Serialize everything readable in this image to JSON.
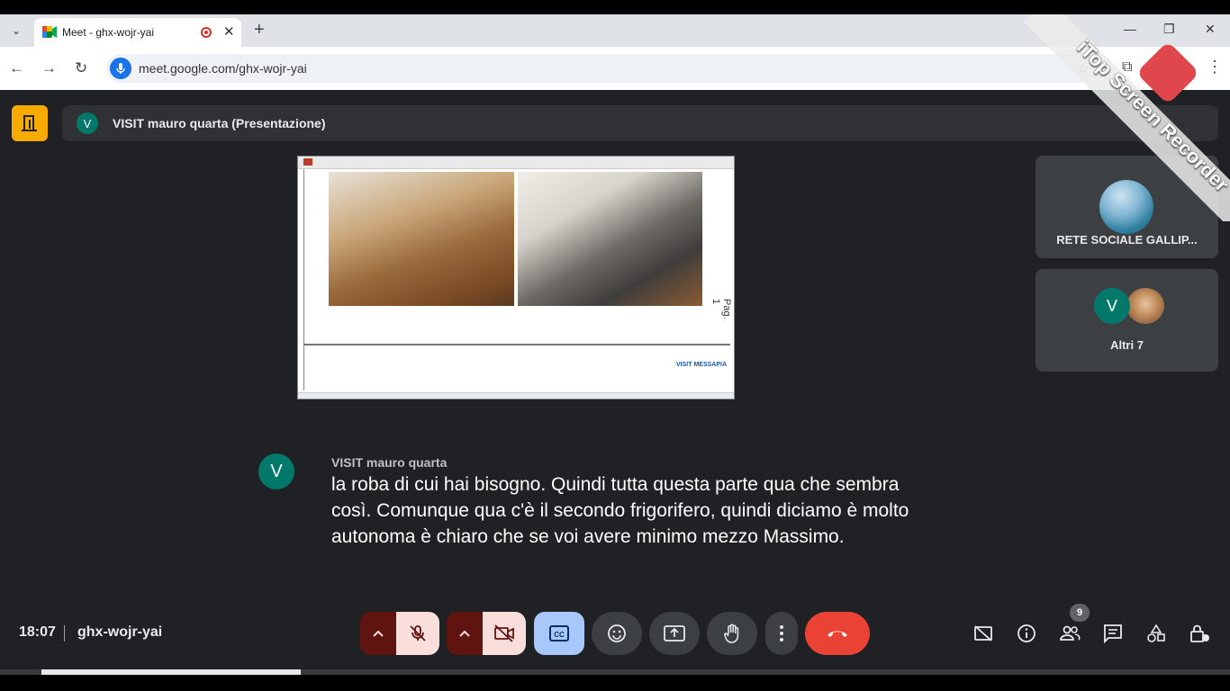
{
  "browser": {
    "tab_title": "Meet - ghx-wojr-yai",
    "tab_close": "✕",
    "new_tab": "+",
    "url": "meet.google.com/ghx-wojr-yai",
    "window_minimize": "—",
    "window_restore": "❐",
    "window_close": "✕"
  },
  "meet": {
    "presenter_initial": "V",
    "presentation_title": "VISIT mauro quarta (Presentazione)",
    "shared_screen": {
      "page_label": "Pag. 1",
      "brand": "VISIT MESSAPIA"
    },
    "participants": [
      {
        "name": "RETE SOCIALE GALLIP..."
      },
      {
        "name": "Altri 7",
        "initial": "V"
      }
    ],
    "caption": {
      "initial": "V",
      "speaker": "VISIT mauro quarta",
      "text": "la roba di cui hai bisogno. Quindi tutta questa parte qua che sembra così. Comunque qua c'è il secondo frigorifero, quindi diciamo è molto autonoma è chiaro che se voi avere minimo mezzo Massimo."
    },
    "clock": "18:07",
    "meeting_code": "ghx-wojr-yai",
    "people_count": "9"
  },
  "watermark": {
    "text": "iTop Screen Recorder"
  },
  "colors": {
    "meet_bg": "#202124",
    "end_call": "#ea4335",
    "captions_on": "#a8c7fa",
    "muted_bg": "#f9dedc",
    "muted_dark": "#601410",
    "avatar_teal": "#00796b",
    "meet_yellow": "#f9ab00"
  }
}
